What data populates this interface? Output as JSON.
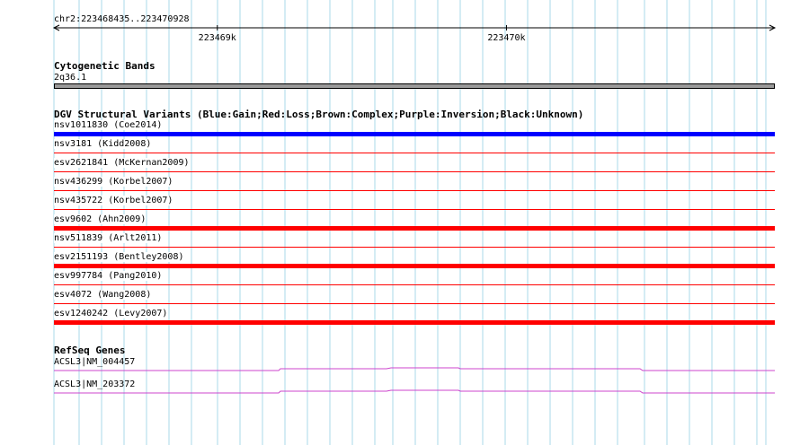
{
  "ruler": {
    "range_label": "chr2:223468435..223470928",
    "ticks": [
      {
        "label": "223469k",
        "pos": 223469000
      },
      {
        "label": "223470k",
        "pos": 223470000
      }
    ],
    "start": 223468435,
    "end": 223470928
  },
  "cytobands": {
    "title": "Cytogenetic Bands",
    "band_label": "2q36.1"
  },
  "dgv": {
    "title": "DGV Structural Variants (Blue:Gain;Red:Loss;Brown:Complex;Purple:Inversion;Black:Unknown)",
    "variants": [
      {
        "label": "nsv1011830 (Coe2014)",
        "type": "gain",
        "thick": true
      },
      {
        "label": "nsv3181 (Kidd2008)",
        "type": "loss",
        "thick": false
      },
      {
        "label": "esv2621841 (McKernan2009)",
        "type": "loss",
        "thick": false
      },
      {
        "label": "nsv436299 (Korbel2007)",
        "type": "loss",
        "thick": false
      },
      {
        "label": "nsv435722 (Korbel2007)",
        "type": "loss",
        "thick": false
      },
      {
        "label": "esv9602 (Ahn2009)",
        "type": "loss",
        "thick": true
      },
      {
        "label": "nsv511839 (Arlt2011)",
        "type": "loss",
        "thick": false
      },
      {
        "label": "esv2151193 (Bentley2008)",
        "type": "loss",
        "thick": true
      },
      {
        "label": "esv997784 (Pang2010)",
        "type": "loss",
        "thick": false
      },
      {
        "label": "esv4072 (Wang2008)",
        "type": "loss",
        "thick": false
      },
      {
        "label": "esv1240242 (Levy2007)",
        "type": "loss",
        "thick": true
      }
    ]
  },
  "refseq": {
    "title": "RefSeq Genes",
    "genes": [
      {
        "label": "ACSL3|NM_004457"
      },
      {
        "label": "ACSL3|NM_203372"
      }
    ]
  },
  "colors": {
    "gain": "#0000ff",
    "loss": "#ff0000",
    "gene": "#cc44cc",
    "grid": "#a8d8ea",
    "band": "#9a9a9a"
  }
}
